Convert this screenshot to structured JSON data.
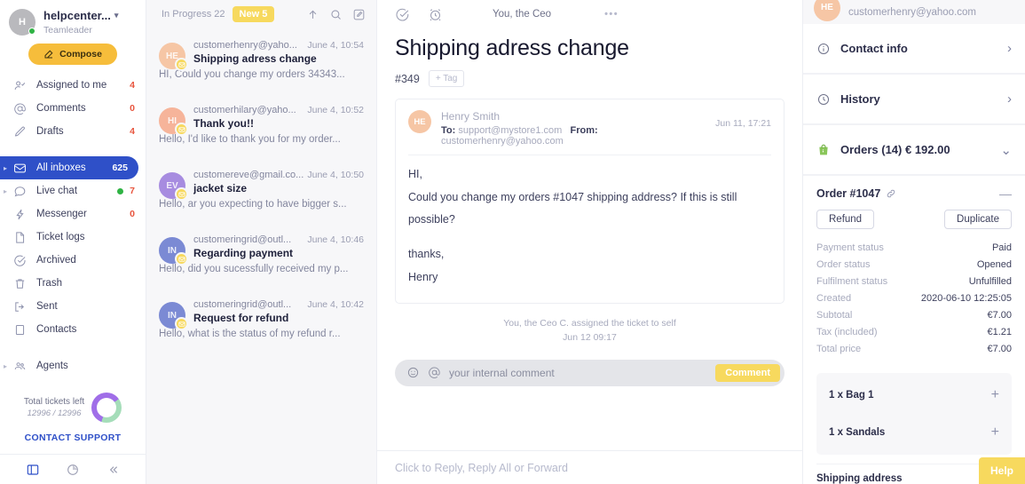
{
  "sidebar": {
    "user": {
      "name": "helpcenter...",
      "role": "Teamleader",
      "initials": "H"
    },
    "compose_label": "Compose",
    "quick_items": [
      {
        "label": "Assigned to me",
        "count": "4",
        "icon": "person-check-icon"
      },
      {
        "label": "Comments",
        "count": "0",
        "icon": "at-icon"
      },
      {
        "label": "Drafts",
        "count": "4",
        "icon": "pencil-icon"
      }
    ],
    "inbox_items": [
      {
        "label": "All inboxes",
        "count": "625",
        "icon": "envelope-icon",
        "active": true,
        "caret": true
      },
      {
        "label": "Live chat",
        "count": "7",
        "icon": "chat-bubble-icon",
        "active": false,
        "caret": true,
        "dot": true
      },
      {
        "label": "Messenger",
        "count": "0",
        "icon": "bolt-icon",
        "active": false
      },
      {
        "label": "Ticket logs",
        "count": "",
        "icon": "document-icon",
        "active": false
      },
      {
        "label": "Archived",
        "count": "",
        "icon": "check-circle-icon",
        "active": false
      },
      {
        "label": "Trash",
        "count": "",
        "icon": "trash-icon",
        "active": false
      },
      {
        "label": "Sent",
        "count": "",
        "icon": "sent-arrow-icon",
        "active": false
      },
      {
        "label": "Contacts",
        "count": "",
        "icon": "book-icon",
        "active": false
      }
    ],
    "agents": {
      "label": "Agents",
      "icon": "people-icon"
    },
    "tickets_left": {
      "title": "Total tickets left",
      "numbers": "12996 / 12996"
    },
    "contact_support": "CONTACT SUPPORT",
    "footer_icons": [
      "panel-layout-icon",
      "pie-chart-icon",
      "collapse-double-chevron-icon"
    ]
  },
  "ticketlist": {
    "status_label": "In Progress 22",
    "new_label": "New 5",
    "actions": [
      "sort-arrow-up-icon",
      "search-icon",
      "compose-edit-icon"
    ],
    "tickets": [
      {
        "from": "customerhenry@yaho...",
        "date": "June 4, 10:54",
        "subject": "Shipping adress change",
        "preview": "HI, Could you change my orders 34343...",
        "initials": "HE",
        "color": "#f6c6a5"
      },
      {
        "from": "customerhilary@yaho...",
        "date": "June 4, 10:52",
        "subject": "Thank you!!",
        "preview": "Hello, I'd like to thank you for  my order...",
        "initials": "HI",
        "color": "#f6b49a"
      },
      {
        "from": "customereve@gmail.co...",
        "date": "June 4, 10:50",
        "subject": "jacket size",
        "preview": "Hello, ar you expecting to have bigger s...",
        "initials": "EV",
        "color": "#a78ce0"
      },
      {
        "from": "customeringrid@outl...",
        "date": "June 4, 10:46",
        "subject": "Regarding payment",
        "preview": "Hello, did you sucessfully received my p...",
        "initials": "IN",
        "color": "#7b8ad4"
      },
      {
        "from": "customeringrid@outl...",
        "date": "June 4, 10:42",
        "subject": "Request for refund",
        "preview": "Hello, what is the status of my refund r...",
        "initials": "IN",
        "color": "#7b8ad4"
      }
    ]
  },
  "conversation": {
    "assignee": "You, the Ceo",
    "more_label": "•••",
    "title": "Shipping adress change",
    "ticket_number": "#349",
    "tag_label": "+ Tag",
    "message": {
      "sender_initials": "HE",
      "sender_name": "Henry Smith",
      "to_label": "To:",
      "to_value": "support@mystore1.com",
      "from_label": "From:",
      "from_value": "customerhenry@yahoo.com",
      "time": "Jun 11, 17:21",
      "greeting": "HI,",
      "line1": "Could you change my orders  #1047 shipping address? If this is still possible?",
      "sign1": "thanks,",
      "sign2": "Henry"
    },
    "system_note_line1": "You, the Ceo C. assigned the ticket to self",
    "system_note_line2": "Jun 12 09:17",
    "comment_placeholder": "your internal comment",
    "comment_button": "Comment",
    "reply_placeholder": "Click to Reply, Reply All or Forward"
  },
  "rightpanel": {
    "contact_email": "customerhenry@yahoo.com",
    "contact_initials": "HE",
    "sections": [
      {
        "label": "Contact info",
        "icon": "info-circle-icon"
      },
      {
        "label": "History",
        "icon": "clock-icon"
      }
    ],
    "orders_header": "Orders (14) € 192.00",
    "order": {
      "title": "Order #1047",
      "refund_label": "Refund",
      "duplicate_label": "Duplicate",
      "fields": [
        {
          "key": "Payment status",
          "value": "Paid"
        },
        {
          "key": "Order status",
          "value": "Opened"
        },
        {
          "key": "Fulfilment status",
          "value": "Unfulfilled"
        },
        {
          "key": "Created",
          "value": "2020-06-10 12:25:05"
        },
        {
          "key": "Subtotal",
          "value": "€7.00"
        },
        {
          "key": "Tax (included)",
          "value": "€1.21"
        },
        {
          "key": "Total price",
          "value": "€7.00"
        }
      ],
      "items": [
        {
          "label": "1 x Bag 1"
        },
        {
          "label": "1 x Sandals"
        }
      ],
      "shipping_label": "Shipping address"
    },
    "help_label": "Help"
  },
  "colors": {
    "accent_blue": "#2f50c8",
    "accent_yellow": "#f6bd3b",
    "badge_yellow": "#f7d95e",
    "danger_red": "#e8553e",
    "green": "#2fb344"
  }
}
